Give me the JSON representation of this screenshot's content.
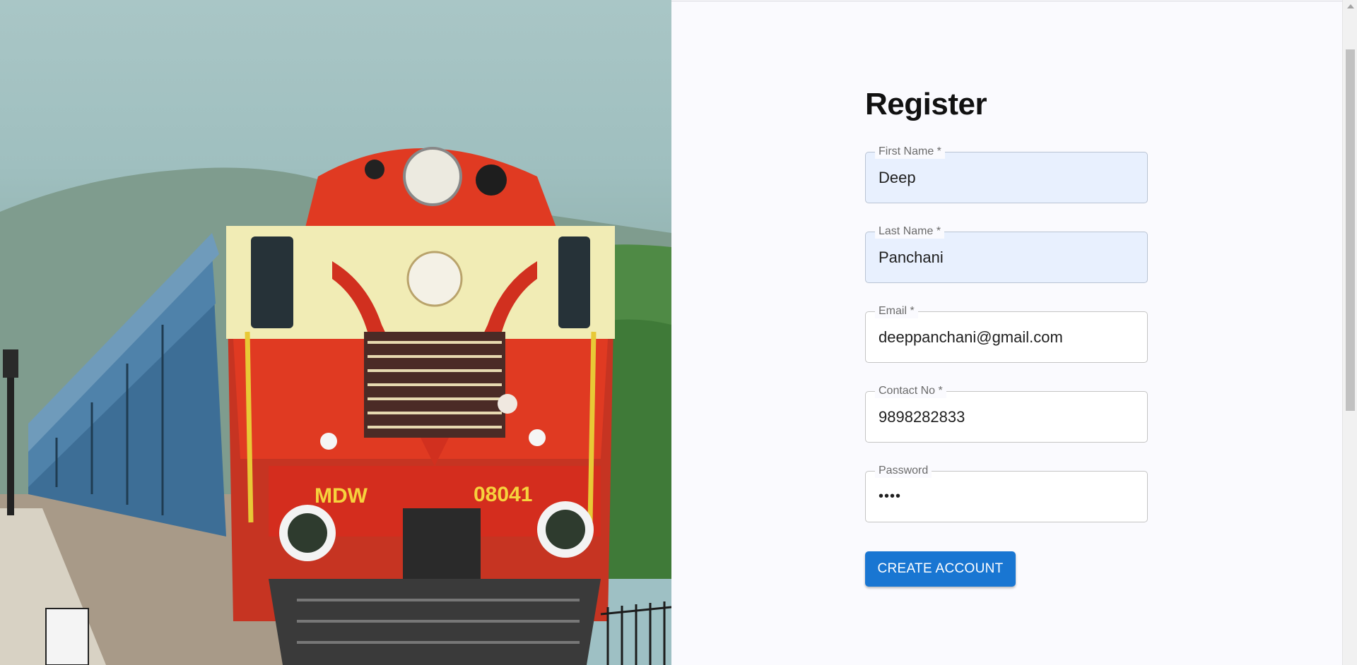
{
  "hero": {
    "image_alt": "Red and cream locomotive leading a blue passenger train",
    "loco_left_text": "MDW",
    "loco_right_text": "08041"
  },
  "form": {
    "title": "Register",
    "fields": [
      {
        "label": "First Name *",
        "value": "Deep"
      },
      {
        "label": "Last Name *",
        "value": "Panchani"
      },
      {
        "label": "Email *",
        "value": "deeppanchani@gmail.com"
      },
      {
        "label": "Contact No *",
        "value": "9898282833"
      },
      {
        "label": "Password",
        "value": "••••"
      }
    ],
    "submit_label": "CREATE ACCOUNT"
  },
  "colors": {
    "primary": "#1976d2",
    "autofill_bg": "#e8f0fe",
    "loco_red": "#e03a22",
    "loco_cream": "#f1ecb5"
  }
}
